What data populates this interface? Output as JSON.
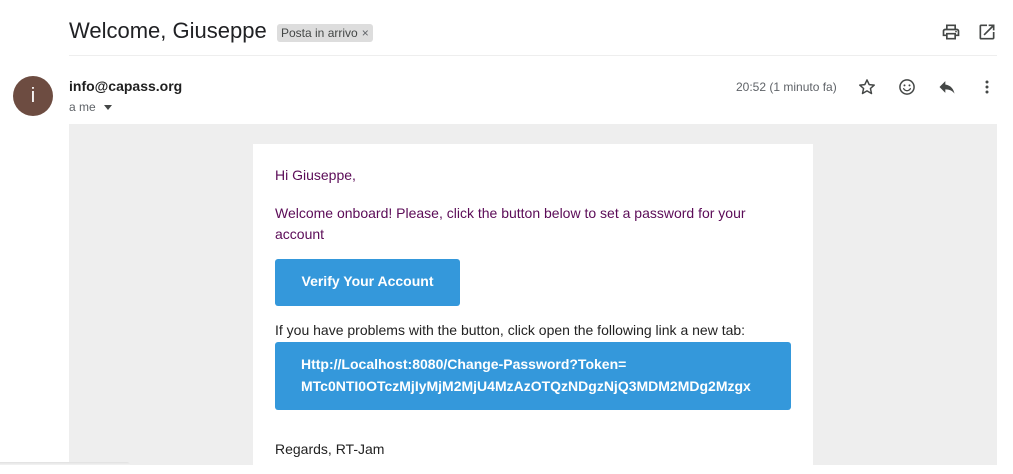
{
  "header": {
    "subject": "Welcome, Giuseppe",
    "label": "Posta in arrivo",
    "label_remove": "×",
    "icons": [
      "print-icon",
      "open-in-new-window-icon"
    ]
  },
  "message": {
    "avatar_letter": "i",
    "avatar_color": "#6d4c41",
    "sender": "info@capass.org",
    "recipient": "a me",
    "time": "20:52 (1 minuto fa)",
    "icons": [
      "star-icon",
      "emoji-reaction-icon",
      "reply-icon",
      "more-vert-icon"
    ]
  },
  "body": {
    "greeting": "Hi Giuseppe,",
    "intro": "Welcome onboard! Please, click the button below to set a password for your account",
    "verify_button": "Verify Your Account",
    "problem_text": "If you have problems with the button, click open the following link a new tab:",
    "link_line1": "Http://Localhost:8080/Change-Password?Token=",
    "link_line2": "MTc0NTI0OTczMjIyMjM2MjU4MzAzOTQzNDgzNjQ3MDM2MDg2Mzgx",
    "regards": "Regards, RT-Jam",
    "accent_color": "#3498db",
    "text_color": "#5b0b57"
  }
}
